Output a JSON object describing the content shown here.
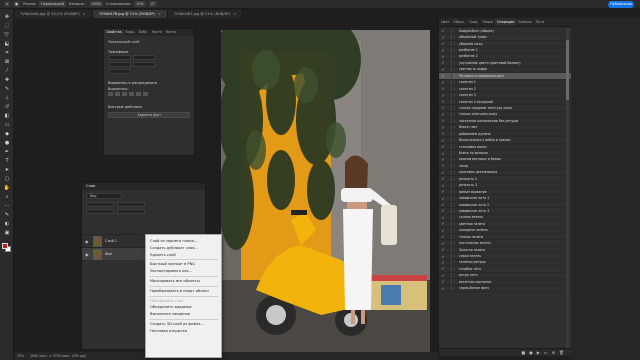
{
  "options_bar": {
    "mode_label": "Режим:",
    "mode_value": "Нормальный",
    "opacity_label": "Непрозр.:",
    "opacity_value": "100%",
    "smoothing_label": "Сглаживание:",
    "smoothing_value": "10%",
    "angle_value": "0°",
    "publish_label": "Публикация"
  },
  "doc_tabs": [
    {
      "label": "7V9A0446.jpg @ 25,5% (RGB/8*)",
      "active": false
    },
    {
      "label": "7V9A0478.jpg @ 21% (RGB/8*)",
      "active": true
    },
    {
      "label": "7V9A0483.jpg @ 21% (RGB/8*)",
      "active": false
    }
  ],
  "status_bar": {
    "zoom": "25%",
    "doc_size": "2640 пикс. × 3754 пикс. (300 ppi)"
  },
  "properties": {
    "tabs": [
      "Свойства",
      "Корр.",
      "Библ.",
      "Кисти",
      "Контр."
    ],
    "layer_kind": "Пиксельный слой",
    "section_transform": "Трансформ.",
    "section_align": "Выровнять и распределить",
    "align_label": "Выровнять:",
    "section_quick": "Быстрые действия",
    "remove_bg": "Удалить фон"
  },
  "layers": {
    "title": "Слои",
    "filter": "Вид",
    "items": [
      {
        "name": "Слой 1",
        "selected": false
      },
      {
        "name": "Фон",
        "selected": true
      }
    ]
  },
  "context_menu": {
    "items": [
      {
        "label": "Слой из заднего плана...",
        "disabled": false
      },
      {
        "label": "Создать дубликат слоя...",
        "disabled": false
      },
      {
        "label": "Удалить слой",
        "disabled": false
      },
      {
        "sep": true
      },
      {
        "label": "Быстрый экспорт в PNG",
        "disabled": false
      },
      {
        "label": "Экспортировать как...",
        "disabled": false
      },
      {
        "sep": true
      },
      {
        "label": "Маскировать все объекты",
        "disabled": false
      },
      {
        "sep": true
      },
      {
        "label": "Преобразовать в смарт-объект",
        "disabled": false
      },
      {
        "sep": true
      },
      {
        "label": "Объединить слои",
        "disabled": true
      },
      {
        "label": "Объединить видимые",
        "disabled": false
      },
      {
        "label": "Выполнить сведение",
        "disabled": false
      },
      {
        "sep": true
      },
      {
        "label": "Создать 3D-слой из файла...",
        "disabled": false
      },
      {
        "label": "Почтовая открытка",
        "disabled": false
      }
    ]
  },
  "actions_panel": {
    "tabs": [
      "Цвет",
      "Образ.",
      "Град.",
      "Узоры",
      "Операции",
      "Каналы",
      "Пути"
    ],
    "active_tab": "Операции",
    "items": [
      "Dodge&Burn (общее)",
      "объемный туман",
      "убираем кожу",
      "разбитие 1",
      "разбитие 2",
      "улучшение цвета (цветовой баланс)",
      "светлость кадра",
      "Четкость и микроконтраст",
      "скинтон 1",
      "скинтон 2",
      "скинтон 3",
      "скинтон 4 холодный",
      "только придаем текстуру коже",
      "только смягчаем кожу",
      "частотное разложение без ретуши",
      "блеск глаз",
      "добавляем румяна",
      "белоснежная улыбка и зрачки",
      "стильевая волос",
      "блеск на волосах",
      "красим ресницы и брови",
      "загар",
      "красивая детализация",
      "резкость 2",
      "резкость 3",
      "виньетирование",
      "хаваючное лето 1",
      "хаваючное лето 2",
      "хаваючное лето 3",
      "сочная зелень",
      "цветная зелень",
      "холодная зелень",
      "теплая зелень",
      "пастельная зелень",
      "Золотая зелень",
      "серая зелень",
      "зеленая ретушь",
      "голубое лето",
      "ретро лето",
      "весенняя картинка",
      "черно-белое фото"
    ],
    "selected_index": 7
  }
}
